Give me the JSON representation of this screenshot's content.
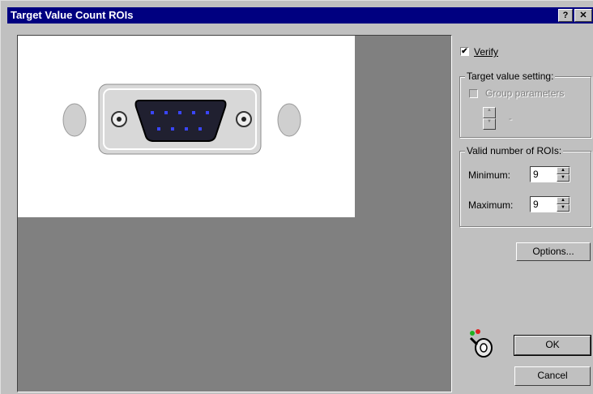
{
  "window": {
    "title": "Target Value Count ROIs",
    "help_glyph": "?",
    "close_glyph": "✕"
  },
  "verify": {
    "label": "Verify",
    "checked": true
  },
  "target_group": {
    "legend": "Target value setting:",
    "group_params_label": "Group parameters",
    "dash": "-"
  },
  "roi_group": {
    "legend": "Valid number of ROIs:",
    "min_label": "Minimum:",
    "min_value": "9",
    "max_label": "Maximum:",
    "max_value": "9"
  },
  "buttons": {
    "options": "Options...",
    "ok": "OK",
    "cancel": "Cancel"
  },
  "icons": {
    "arrow_up": "▲",
    "arrow_down": "▼",
    "check": "✔"
  }
}
